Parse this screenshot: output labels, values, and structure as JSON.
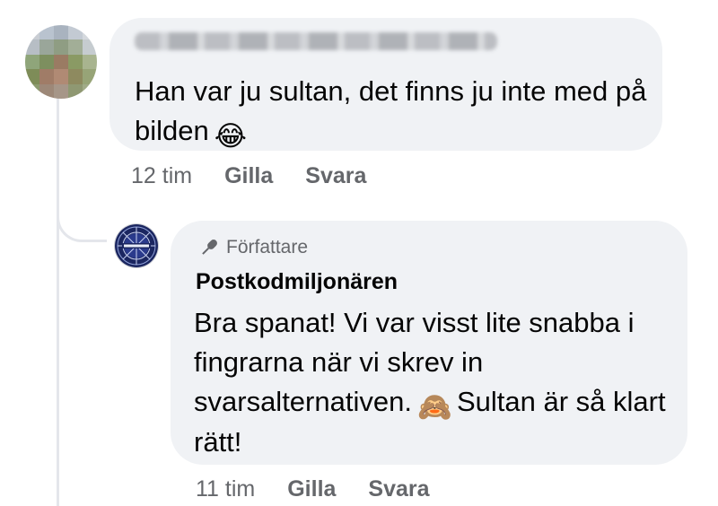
{
  "comment": {
    "author_name": "",
    "text": "Han var ju sultan, det finns ju inte med på bilden",
    "emoji": "😂",
    "time": "12 tim",
    "like_label": "Gilla",
    "reply_label": "Svara"
  },
  "reply": {
    "badge_label": "Författare",
    "author_name": "Postkodmiljonären",
    "text_part1": "Bra spanat! Vi var visst lite snabba i fingrarna när vi skrev in svarsalternativen.",
    "emoji": "🙈",
    "text_part2": "Sultan är så klart rätt!",
    "time": "11 tim",
    "like_label": "Gilla",
    "reply_label": "Svara"
  },
  "icons": {
    "badge_icon": "microphone-icon",
    "commenter_avatar": "blurred-avatar",
    "page_avatar": "postkodmiljonaren-logo"
  },
  "colors": {
    "bubble": "#f0f2f5",
    "meta_text": "#65676b",
    "body_text": "#050505",
    "thread_line": "#e4e6eb"
  }
}
